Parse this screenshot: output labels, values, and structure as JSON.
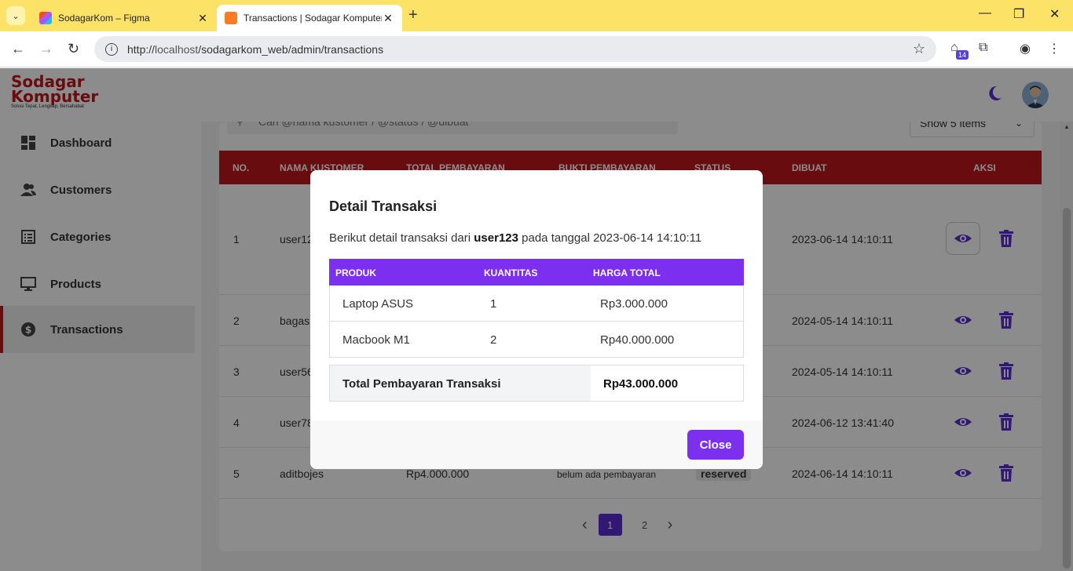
{
  "browser": {
    "tabs": [
      {
        "title": "SodagarKom – Figma"
      },
      {
        "title": "Transactions | Sodagar Komputer"
      }
    ],
    "url_prefix": "http://",
    "url_host": "localhost",
    "url_path": "/sodagarkom_web/admin/transactions",
    "extension_badge": "14",
    "icons": {
      "back": "back-arrow-icon",
      "forward": "forward-arrow-icon",
      "reload": "reload-icon"
    }
  },
  "brand": {
    "line1": "Sodagar",
    "line2": "Komputer",
    "tagline": "Solusi Tepat, Lengkap, Bersahabat"
  },
  "sidebar": {
    "items": [
      {
        "label": "Dashboard",
        "icon": "dashboard-icon"
      },
      {
        "label": "Customers",
        "icon": "users-icon"
      },
      {
        "label": "Categories",
        "icon": "list-icon"
      },
      {
        "label": "Products",
        "icon": "monitor-icon"
      },
      {
        "label": "Transactions",
        "icon": "dollar-icon",
        "active": true
      }
    ]
  },
  "toolbar": {
    "search_placeholder": "Cari @nama kustomer / @status / @dibuat",
    "page_size": "Show 5 items"
  },
  "table": {
    "headers": [
      "NO.",
      "NAMA KUSTOMER",
      "TOTAL PEMBAYARAN",
      "BUKTI PEMBAYARAN",
      "STATUS",
      "DIBUAT",
      "AKSI"
    ],
    "rows": [
      {
        "no": "1",
        "customer": "user123",
        "total": "",
        "proof": "",
        "status": "",
        "created": "2023-06-14 14:10:11"
      },
      {
        "no": "2",
        "customer": "bagas",
        "total": "",
        "proof": "",
        "status": "",
        "created": "2024-05-14 14:10:11"
      },
      {
        "no": "3",
        "customer": "user56",
        "total": "",
        "proof": "",
        "status": "",
        "created": "2024-05-14 14:10:11"
      },
      {
        "no": "4",
        "customer": "user78",
        "total": "",
        "proof": "",
        "status": "",
        "created": "2024-06-12 13:41:40"
      },
      {
        "no": "5",
        "customer": "aditbojes",
        "total": "Rp4.000.000",
        "proof": "belum ada pembayaran",
        "status": "reserved",
        "created": "2024-06-14 14:10:11"
      }
    ]
  },
  "pagination": {
    "pages": [
      "1",
      "2"
    ],
    "current": "1",
    "prev": "‹",
    "next": "›"
  },
  "modal": {
    "title": "Detail Transaksi",
    "desc_prefix": "Berikut detail transaksi dari",
    "desc_user": "user123",
    "desc_mid": "pada tanggal",
    "desc_date": "2023-06-14 14:10:11",
    "headers": [
      "PRODUK",
      "KUANTITAS",
      "HARGA TOTAL"
    ],
    "items": [
      {
        "product": "Laptop ASUS",
        "qty": "1",
        "price": "Rp3.000.000"
      },
      {
        "product": "Macbook M1",
        "qty": "2",
        "price": "Rp40.000.000"
      }
    ],
    "total_label": "Total Pembayaran Transaksi",
    "total_value": "Rp43.000.000",
    "close_label": "Close"
  },
  "colors": {
    "brand_red": "#c0161d",
    "accent_purple": "#7d2ff0",
    "action_purple": "#5b2bd6"
  }
}
